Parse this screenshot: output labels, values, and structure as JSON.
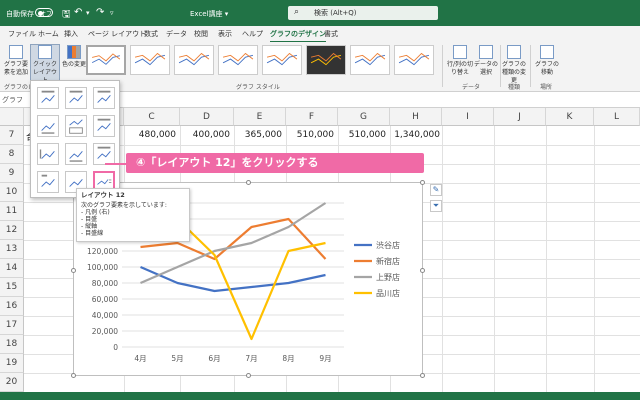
{
  "titlebar": {
    "autosave_label": "自動保存",
    "autosave_state": "オフ",
    "app_title": "Excel講座 ▾",
    "search_placeholder": "検索 (Alt+Q)"
  },
  "tabs": [
    "ファイル",
    "ホーム",
    "挿入",
    "ページ レイアウト",
    "数式",
    "データ",
    "校閲",
    "表示",
    "ヘルプ",
    "グラフのデザイン",
    "書式"
  ],
  "active_tab": "グラフのデザイン",
  "ribbon": {
    "add_element": "グラフ要素を追加",
    "quick_layout": "クイック レイアウト",
    "change_colors": "色の変更",
    "switch_row_col": "行/列の切り替え",
    "select_data": "データの選択",
    "change_type": "グラフの種類の変更",
    "move_chart": "グラフの移動",
    "group_styles": "グラフ スタイル",
    "group_data": "データ",
    "group_type": "種類",
    "group_location": "場所",
    "group_layouts": "グラフのレ"
  },
  "formula_bar": {
    "name_box": "グラフ"
  },
  "grid": {
    "columns": [
      "C",
      "D",
      "E",
      "F",
      "G",
      "H",
      "I",
      "J",
      "K",
      "L"
    ],
    "rows": [
      "7",
      "8",
      "9",
      "10",
      "11",
      "12",
      "13",
      "14",
      "15",
      "16",
      "17",
      "18",
      "19",
      "20",
      "21"
    ],
    "row7_prefix": "合",
    "row7_values": [
      "480,000",
      "400,000",
      "365,000",
      "510,000",
      "510,000",
      "1,340,000"
    ]
  },
  "callout": {
    "text": "④「レイアウト 12」をクリックする"
  },
  "tooltip": {
    "title": "レイアウト 12",
    "intro": "次のグラフ要素を示しています:",
    "items": [
      "- 凡例 (右)",
      "- 目盛",
      "- 縦軸",
      "- 目盛線"
    ]
  },
  "colors": {
    "excel_green": "#217346",
    "callout_pink": "#f06aa6",
    "series_blue": "#4472c4",
    "series_orange": "#ed7d31",
    "series_gray": "#a5a5a5",
    "series_yellow": "#ffc000"
  },
  "chart_data": {
    "type": "line",
    "categories": [
      "4月",
      "5月",
      "6月",
      "7月",
      "8月",
      "9月"
    ],
    "ylim": [
      0,
      180000
    ],
    "yticks": [
      "0",
      "20,000",
      "40,000",
      "60,000",
      "80,000",
      "100,000",
      "120,000",
      "140,000",
      "160,000",
      "180,000"
    ],
    "series": [
      {
        "name": "渋谷店",
        "color": "#4472c4",
        "values": [
          100000,
          80000,
          70000,
          75000,
          80000,
          90000
        ]
      },
      {
        "name": "新宿店",
        "color": "#ed7d31",
        "values": [
          125000,
          130000,
          110000,
          150000,
          160000,
          110000
        ]
      },
      {
        "name": "上野店",
        "color": "#a5a5a5",
        "values": [
          80000,
          100000,
          120000,
          130000,
          150000,
          180000
        ]
      },
      {
        "name": "品川店",
        "color": "#ffc000",
        "values": [
          150000,
          160000,
          115000,
          10000,
          120000,
          130000
        ]
      }
    ]
  }
}
